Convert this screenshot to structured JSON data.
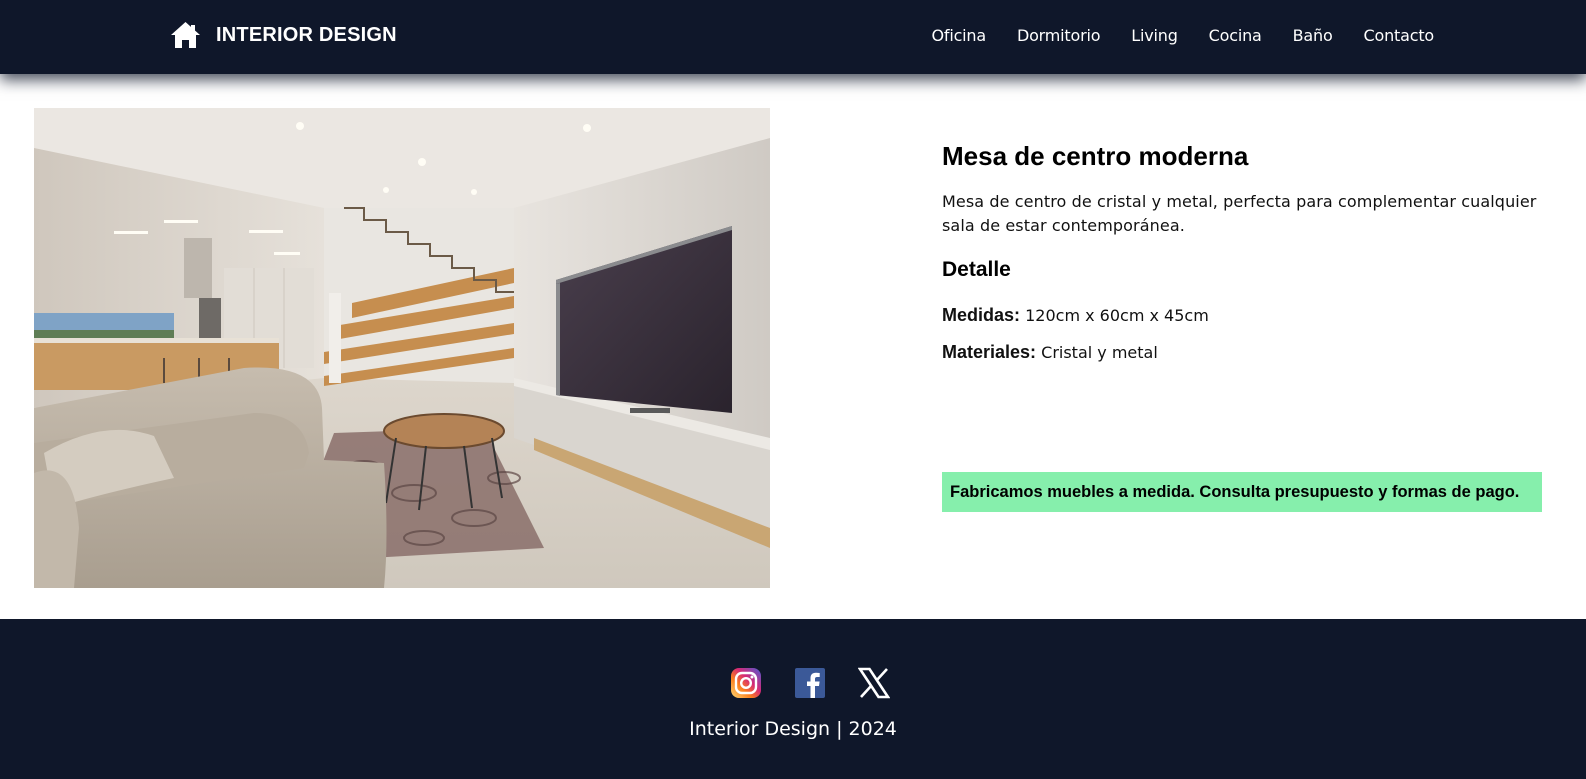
{
  "brand": {
    "name": "INTERIOR DESIGN",
    "icon": "home-icon"
  },
  "nav": {
    "items": [
      {
        "label": "Oficina"
      },
      {
        "label": "Dormitorio"
      },
      {
        "label": "Living"
      },
      {
        "label": "Cocina"
      },
      {
        "label": "Baño"
      },
      {
        "label": "Contacto"
      }
    ]
  },
  "product": {
    "image_subject": "living-room-photo",
    "title": "Mesa de centro moderna",
    "description": "Mesa de centro de cristal y metal, perfecta para complementar cualquier sala de estar contemporánea.",
    "detail_heading": "Detalle",
    "specs": [
      {
        "label": "Medidas:",
        "value": "120cm x 60cm x 45cm"
      },
      {
        "label": "Materiales:",
        "value": "Cristal y metal"
      }
    ],
    "promo": "Fabricamos muebles a medida. Consulta presupuesto y formas de pago."
  },
  "footer": {
    "socials": [
      {
        "name": "instagram-icon"
      },
      {
        "name": "facebook-icon"
      },
      {
        "name": "x-icon"
      }
    ],
    "copyright": "Interior Design | 2024"
  },
  "colors": {
    "header_bg": "#0f172a",
    "footer_bg": "#0f172a",
    "promo_bg": "#86efac",
    "text_light": "#ffffff"
  }
}
